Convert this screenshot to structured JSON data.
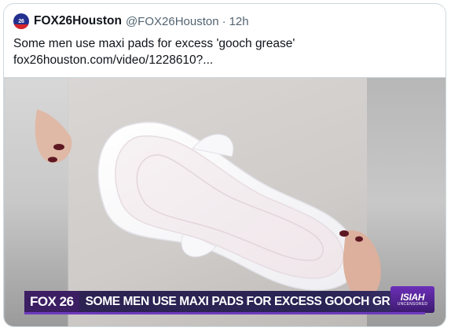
{
  "tweet": {
    "avatar_text": "26",
    "display_name": "FOX26Houston",
    "handle": "@FOX26Houston",
    "separator": "·",
    "timestamp": "12h",
    "text_line1": "Some men use maxi pads for excess 'gooch grease'",
    "text_line2": "fox26houston.com/video/1228610?..."
  },
  "media": {
    "station_logo": "FOX 26",
    "headline": "SOME MEN USE MAXI PADS FOR EXCESS GOOCH GREASE",
    "show_logo_top": "ISIAH",
    "show_logo_bottom": "UNCENSORED"
  },
  "colors": {
    "text_primary": "#0f1419",
    "text_secondary": "#536471",
    "border": "#cfd9de",
    "lower_third_purple": "#3c1e63",
    "nail_polish": "#5e1822"
  }
}
